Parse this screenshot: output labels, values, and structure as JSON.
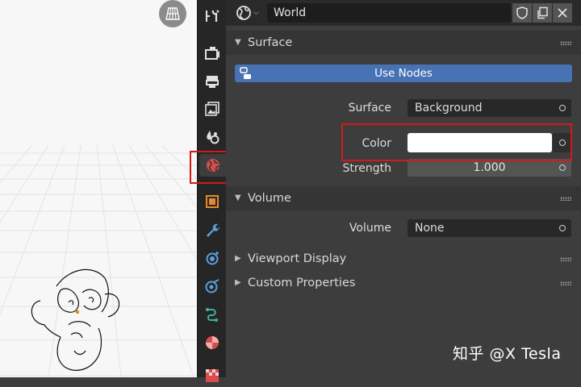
{
  "header": {
    "world_name": "World",
    "type_icon": "world-icon",
    "buttons": [
      "fake-user-shield-icon",
      "duplicate-icon",
      "unlink-icon"
    ]
  },
  "tabs": [
    {
      "name": "tool",
      "icon": "tool-icon"
    },
    {
      "name": "render",
      "icon": "render-icon"
    },
    {
      "name": "output",
      "icon": "output-icon"
    },
    {
      "name": "view-layer",
      "icon": "view-layer-icon"
    },
    {
      "name": "scene",
      "icon": "scene-icon"
    },
    {
      "name": "world",
      "icon": "world-icon",
      "active": true
    },
    {
      "name": "object",
      "icon": "object-icon"
    },
    {
      "name": "modifiers",
      "icon": "wrench-icon"
    },
    {
      "name": "particles",
      "icon": "particles-icon"
    },
    {
      "name": "physics",
      "icon": "physics-icon"
    },
    {
      "name": "object-constraints",
      "icon": "constraint-icon"
    },
    {
      "name": "object-data",
      "icon": "data-icon"
    },
    {
      "name": "material",
      "icon": "material-icon"
    },
    {
      "name": "texture",
      "icon": "texture-icon"
    }
  ],
  "surface_panel": {
    "title": "Surface",
    "use_nodes_label": "Use Nodes",
    "surface_label": "Surface",
    "surface_value": "Background",
    "color_label": "Color",
    "color_value": "#ffffff",
    "strength_label": "Strength",
    "strength_value": "1.000"
  },
  "volume_panel": {
    "title": "Volume",
    "volume_label": "Volume",
    "volume_value": "None"
  },
  "collapsed_panels": {
    "viewport_display": "Viewport Display",
    "custom_properties": "Custom Properties"
  },
  "watermark": "知乎 @X Tesla",
  "colors": {
    "accent": "#4772b3",
    "highlight_box": "#d11a1a"
  }
}
